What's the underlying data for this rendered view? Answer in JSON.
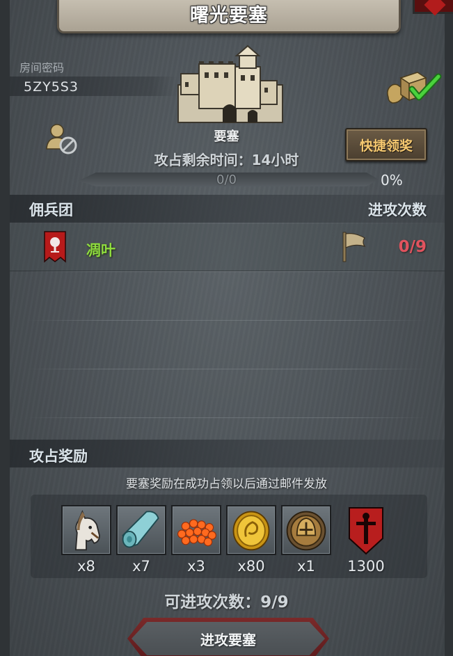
{
  "header": {
    "title": "曙光要塞"
  },
  "room": {
    "label": "房间密码",
    "code": "5ZY5S3"
  },
  "fortress": {
    "name": "要塞",
    "remaining_time": "攻占剩余时间：14小时",
    "progress_text": "0/0",
    "progress_percent": "0%",
    "progress_value": 0
  },
  "claim_button": {
    "label": "快捷领奖"
  },
  "mercenary": {
    "section_title": "佣兵团",
    "attack_count_title": "进攻次数",
    "rows": [
      {
        "name": "凋叶",
        "count": "0/9",
        "name_color": "#8fdc3e"
      }
    ]
  },
  "rewards": {
    "section_title": "攻占奖励",
    "note": "要塞奖励在成功占领以后通过邮件发放",
    "items": [
      {
        "icon": "horse-icon",
        "qty": "x8"
      },
      {
        "icon": "cloth-icon",
        "qty": "x7"
      },
      {
        "icon": "berries-icon",
        "qty": "x3"
      },
      {
        "icon": "gold-coin-icon",
        "qty": "x80"
      },
      {
        "icon": "helmet-icon",
        "qty": "x1"
      }
    ],
    "rank": {
      "icon": "sword-banner-icon",
      "value": "1300"
    }
  },
  "footer": {
    "attack_remaining": "可进攻次数：9/9",
    "attack_button": "进攻要塞"
  }
}
